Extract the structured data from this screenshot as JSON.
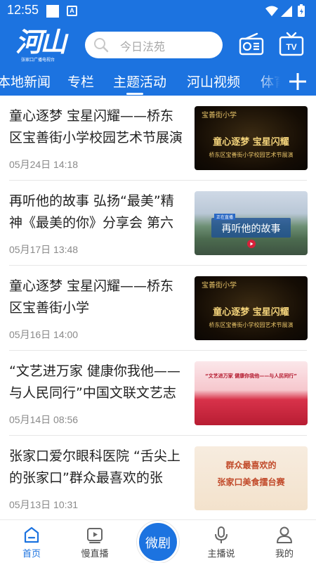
{
  "status_bar": {
    "time": "12:55",
    "badge": "A"
  },
  "header": {
    "logo_text": "河山",
    "logo_subtitle": "张家口广播电视台",
    "search_placeholder": "今日法苑"
  },
  "tabs": [
    {
      "label": "本地新闻"
    },
    {
      "label": "专栏"
    },
    {
      "label": "主题活动"
    },
    {
      "label": "河山视频"
    },
    {
      "label": "体育"
    }
  ],
  "news": [
    {
      "title": "童心逐梦 宝星闪耀——桥东区宝善街小学校园艺术节展演",
      "date": "05月24日 14:18",
      "thumb": {
        "line1": "童心逐梦 宝星闪耀",
        "line2": "桥东区宝善街小学校园艺术节展演",
        "header": "宝善街小学"
      }
    },
    {
      "title": "再听他的故事 弘扬“最美”精神《最美的你》分享会 第六站…",
      "date": "05月17日 13:48",
      "thumb": {
        "line1": "再听他的故事",
        "tag": "正在直播"
      }
    },
    {
      "title": "童心逐梦 宝星闪耀——桥东区宝善街小学",
      "date": "05月16日 14:00",
      "thumb": {
        "line1": "童心逐梦 宝星闪耀",
        "line2": "桥东区宝善街小学校园艺术节展演",
        "header": "宝善街小学"
      }
    },
    {
      "title": "“文艺进万家 健康你我他——与人民同行”中国文联文艺志愿…",
      "date": "05月14日 08:56",
      "thumb": {
        "line1": "“文艺进万家 健康你我他——与人民同行”"
      }
    },
    {
      "title": "张家口爱尔眼科医院 “舌尖上的张家口”群众最喜欢的张家…",
      "date": "05月13日 10:31",
      "thumb": {
        "line1": "群众最喜欢的",
        "line2": "张家口美食擂台赛"
      }
    }
  ],
  "bottom_nav": {
    "home": "首页",
    "slow_live": "慢直播",
    "center": "微剧",
    "anchor": "主播说",
    "mine": "我的"
  },
  "colors": {
    "brand": "#1c73e0",
    "text": "#222222",
    "muted": "#8a8a8a"
  }
}
